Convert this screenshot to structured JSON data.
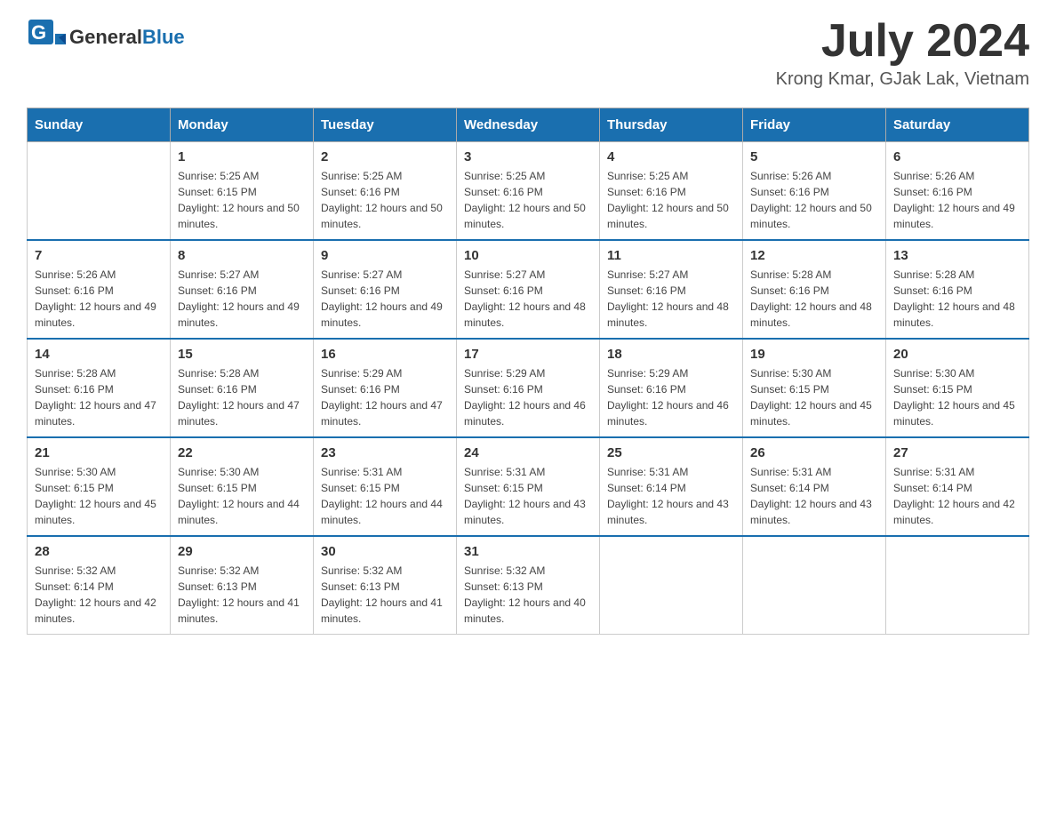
{
  "header": {
    "logo_text_general": "General",
    "logo_text_blue": "Blue",
    "month_title": "July 2024",
    "location": "Krong Kmar, GJak Lak, Vietnam"
  },
  "weekdays": [
    "Sunday",
    "Monday",
    "Tuesday",
    "Wednesday",
    "Thursday",
    "Friday",
    "Saturday"
  ],
  "weeks": [
    [
      {
        "day": "",
        "sunrise": "",
        "sunset": "",
        "daylight": ""
      },
      {
        "day": "1",
        "sunrise": "Sunrise: 5:25 AM",
        "sunset": "Sunset: 6:15 PM",
        "daylight": "Daylight: 12 hours and 50 minutes."
      },
      {
        "day": "2",
        "sunrise": "Sunrise: 5:25 AM",
        "sunset": "Sunset: 6:16 PM",
        "daylight": "Daylight: 12 hours and 50 minutes."
      },
      {
        "day": "3",
        "sunrise": "Sunrise: 5:25 AM",
        "sunset": "Sunset: 6:16 PM",
        "daylight": "Daylight: 12 hours and 50 minutes."
      },
      {
        "day": "4",
        "sunrise": "Sunrise: 5:25 AM",
        "sunset": "Sunset: 6:16 PM",
        "daylight": "Daylight: 12 hours and 50 minutes."
      },
      {
        "day": "5",
        "sunrise": "Sunrise: 5:26 AM",
        "sunset": "Sunset: 6:16 PM",
        "daylight": "Daylight: 12 hours and 50 minutes."
      },
      {
        "day": "6",
        "sunrise": "Sunrise: 5:26 AM",
        "sunset": "Sunset: 6:16 PM",
        "daylight": "Daylight: 12 hours and 49 minutes."
      }
    ],
    [
      {
        "day": "7",
        "sunrise": "Sunrise: 5:26 AM",
        "sunset": "Sunset: 6:16 PM",
        "daylight": "Daylight: 12 hours and 49 minutes."
      },
      {
        "day": "8",
        "sunrise": "Sunrise: 5:27 AM",
        "sunset": "Sunset: 6:16 PM",
        "daylight": "Daylight: 12 hours and 49 minutes."
      },
      {
        "day": "9",
        "sunrise": "Sunrise: 5:27 AM",
        "sunset": "Sunset: 6:16 PM",
        "daylight": "Daylight: 12 hours and 49 minutes."
      },
      {
        "day": "10",
        "sunrise": "Sunrise: 5:27 AM",
        "sunset": "Sunset: 6:16 PM",
        "daylight": "Daylight: 12 hours and 48 minutes."
      },
      {
        "day": "11",
        "sunrise": "Sunrise: 5:27 AM",
        "sunset": "Sunset: 6:16 PM",
        "daylight": "Daylight: 12 hours and 48 minutes."
      },
      {
        "day": "12",
        "sunrise": "Sunrise: 5:28 AM",
        "sunset": "Sunset: 6:16 PM",
        "daylight": "Daylight: 12 hours and 48 minutes."
      },
      {
        "day": "13",
        "sunrise": "Sunrise: 5:28 AM",
        "sunset": "Sunset: 6:16 PM",
        "daylight": "Daylight: 12 hours and 48 minutes."
      }
    ],
    [
      {
        "day": "14",
        "sunrise": "Sunrise: 5:28 AM",
        "sunset": "Sunset: 6:16 PM",
        "daylight": "Daylight: 12 hours and 47 minutes."
      },
      {
        "day": "15",
        "sunrise": "Sunrise: 5:28 AM",
        "sunset": "Sunset: 6:16 PM",
        "daylight": "Daylight: 12 hours and 47 minutes."
      },
      {
        "day": "16",
        "sunrise": "Sunrise: 5:29 AM",
        "sunset": "Sunset: 6:16 PM",
        "daylight": "Daylight: 12 hours and 47 minutes."
      },
      {
        "day": "17",
        "sunrise": "Sunrise: 5:29 AM",
        "sunset": "Sunset: 6:16 PM",
        "daylight": "Daylight: 12 hours and 46 minutes."
      },
      {
        "day": "18",
        "sunrise": "Sunrise: 5:29 AM",
        "sunset": "Sunset: 6:16 PM",
        "daylight": "Daylight: 12 hours and 46 minutes."
      },
      {
        "day": "19",
        "sunrise": "Sunrise: 5:30 AM",
        "sunset": "Sunset: 6:15 PM",
        "daylight": "Daylight: 12 hours and 45 minutes."
      },
      {
        "day": "20",
        "sunrise": "Sunrise: 5:30 AM",
        "sunset": "Sunset: 6:15 PM",
        "daylight": "Daylight: 12 hours and 45 minutes."
      }
    ],
    [
      {
        "day": "21",
        "sunrise": "Sunrise: 5:30 AM",
        "sunset": "Sunset: 6:15 PM",
        "daylight": "Daylight: 12 hours and 45 minutes."
      },
      {
        "day": "22",
        "sunrise": "Sunrise: 5:30 AM",
        "sunset": "Sunset: 6:15 PM",
        "daylight": "Daylight: 12 hours and 44 minutes."
      },
      {
        "day": "23",
        "sunrise": "Sunrise: 5:31 AM",
        "sunset": "Sunset: 6:15 PM",
        "daylight": "Daylight: 12 hours and 44 minutes."
      },
      {
        "day": "24",
        "sunrise": "Sunrise: 5:31 AM",
        "sunset": "Sunset: 6:15 PM",
        "daylight": "Daylight: 12 hours and 43 minutes."
      },
      {
        "day": "25",
        "sunrise": "Sunrise: 5:31 AM",
        "sunset": "Sunset: 6:14 PM",
        "daylight": "Daylight: 12 hours and 43 minutes."
      },
      {
        "day": "26",
        "sunrise": "Sunrise: 5:31 AM",
        "sunset": "Sunset: 6:14 PM",
        "daylight": "Daylight: 12 hours and 43 minutes."
      },
      {
        "day": "27",
        "sunrise": "Sunrise: 5:31 AM",
        "sunset": "Sunset: 6:14 PM",
        "daylight": "Daylight: 12 hours and 42 minutes."
      }
    ],
    [
      {
        "day": "28",
        "sunrise": "Sunrise: 5:32 AM",
        "sunset": "Sunset: 6:14 PM",
        "daylight": "Daylight: 12 hours and 42 minutes."
      },
      {
        "day": "29",
        "sunrise": "Sunrise: 5:32 AM",
        "sunset": "Sunset: 6:13 PM",
        "daylight": "Daylight: 12 hours and 41 minutes."
      },
      {
        "day": "30",
        "sunrise": "Sunrise: 5:32 AM",
        "sunset": "Sunset: 6:13 PM",
        "daylight": "Daylight: 12 hours and 41 minutes."
      },
      {
        "day": "31",
        "sunrise": "Sunrise: 5:32 AM",
        "sunset": "Sunset: 6:13 PM",
        "daylight": "Daylight: 12 hours and 40 minutes."
      },
      {
        "day": "",
        "sunrise": "",
        "sunset": "",
        "daylight": ""
      },
      {
        "day": "",
        "sunrise": "",
        "sunset": "",
        "daylight": ""
      },
      {
        "day": "",
        "sunrise": "",
        "sunset": "",
        "daylight": ""
      }
    ]
  ]
}
